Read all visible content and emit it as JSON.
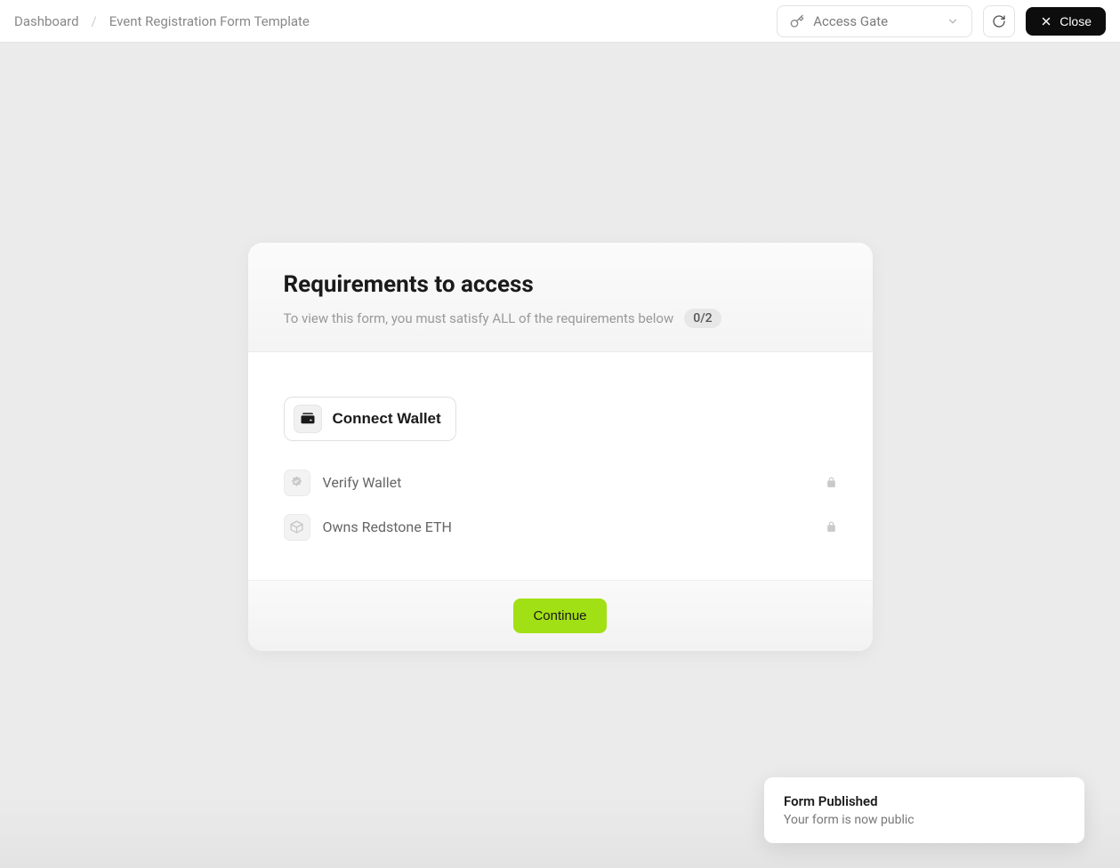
{
  "header": {
    "breadcrumb": {
      "dashboard": "Dashboard",
      "current": "Event Registration Form Template"
    },
    "access_gate_label": "Access Gate",
    "close_label": "Close"
  },
  "card": {
    "title": "Requirements to access",
    "subtitle": "To view this form, you must satisfy ALL of the requirements below",
    "progress_badge": "0/2",
    "connect_wallet_label": "Connect Wallet",
    "requirements": [
      {
        "label": "Verify Wallet",
        "icon": "verify"
      },
      {
        "label": "Owns Redstone ETH",
        "icon": "cube"
      }
    ],
    "continue_label": "Continue"
  },
  "toast": {
    "title": "Form Published",
    "body": "Your form is now public"
  },
  "colors": {
    "accent": "#a1e014",
    "bg": "#ebebeb",
    "dark": "#0d0d0d"
  }
}
